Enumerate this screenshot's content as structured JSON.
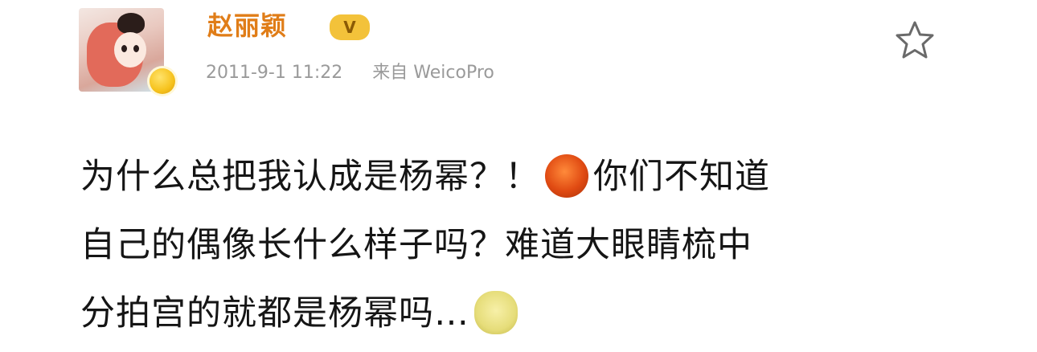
{
  "post": {
    "author": "赵丽颖",
    "vip_badge": "V",
    "timestamp": "2011-9-1 11:22",
    "source_prefix": "来自",
    "source": "WeicoPro",
    "content_lines": [
      {
        "text_before": "为什么总把我认成是杨幂？！",
        "emoji": "angry-face-emoji",
        "text_after": "你们不知道"
      },
      {
        "text_before": "自己的偶像长什么样子吗？难道大眼睛梳中",
        "emoji": "",
        "text_after": ""
      },
      {
        "text_before": "分拍宫的就都是杨幂吗…",
        "emoji": "cat-face-emoji",
        "text_after": ""
      }
    ]
  },
  "icons": {
    "favorite": "star-outline-icon",
    "verified": "verified-badge-icon"
  },
  "colors": {
    "author": "#e07d18",
    "meta": "#9a9a9a",
    "text": "#151515",
    "badge": "#f3c23a"
  }
}
